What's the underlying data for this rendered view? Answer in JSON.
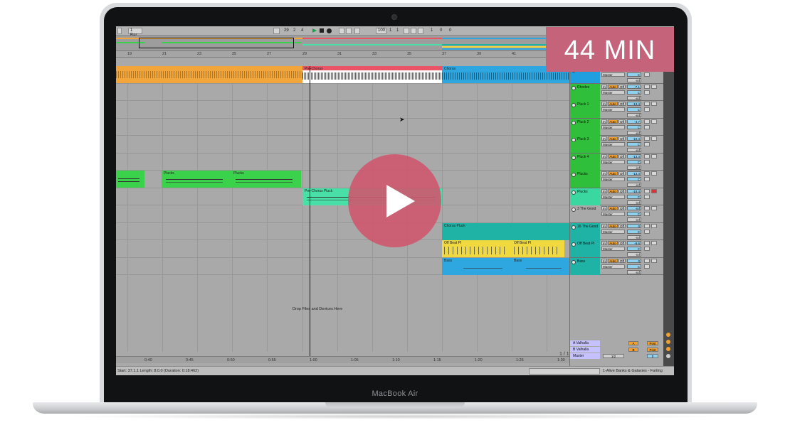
{
  "device": {
    "brand": "MacBook Air"
  },
  "overlay": {
    "duration_badge": "44 MIN",
    "play_button": "play-icon"
  },
  "transport": {
    "quantize": "1 Bar",
    "position": [
      "29",
      "2",
      "4"
    ],
    "tempo": "100",
    "meter": [
      "1",
      "1"
    ],
    "end": [
      "1",
      "0",
      "0"
    ]
  },
  "ruler": {
    "bars": [
      "19",
      "21",
      "23",
      "25",
      "27",
      "29",
      "31",
      "33",
      "35",
      "37",
      "39",
      "41",
      "43"
    ]
  },
  "bottom_ruler": {
    "times": [
      "0:40",
      "0:45",
      "0:50",
      "0:55",
      "1:00",
      "1:05",
      "1:10",
      "1:15",
      "1:20",
      "1:25",
      "1:30"
    ]
  },
  "arrangement": {
    "clips": [
      {
        "track": 0,
        "label": "Pre-Chorus"
      },
      {
        "track": 0,
        "label": "Chorus"
      },
      {
        "track": 6,
        "label": "Plucks"
      },
      {
        "track": 6,
        "label": "Plucks"
      },
      {
        "track": 7,
        "label": "Pre-Chorus Pluck"
      },
      {
        "track": 9,
        "label": "Chorus Pluck"
      },
      {
        "track": 10,
        "label": "Off Beat Pl"
      },
      {
        "track": 10,
        "label": "Off Beat Pl"
      },
      {
        "track": 11,
        "label": "Bass"
      },
      {
        "track": 11,
        "label": "Bass"
      }
    ],
    "drop_hint": "Drop Files and Devices Here",
    "page_indicator": "1 / 1"
  },
  "tracks": [
    {
      "name": "",
      "color": "#1f9ee0",
      "send": "Master",
      "vol": "-13.6",
      "pan": "C"
    },
    {
      "name": "Rhodes",
      "color": "#2fbf3a",
      "send": "Master",
      "vol": "-7.1",
      "pan": "C"
    },
    {
      "name": "Pluck 1",
      "color": "#2fbf3a",
      "send": "Master",
      "vol": "-13.4",
      "pan": "C"
    },
    {
      "name": "Pluck 2",
      "color": "#2fbf3a",
      "send": "Master",
      "vol": "-4.7",
      "pan": "C"
    },
    {
      "name": "Pluck 3",
      "color": "#2fbf3a",
      "send": "Master",
      "vol": "-19.4",
      "pan": "C"
    },
    {
      "name": "Pluck 4",
      "color": "#2fbf3a",
      "send": "Master",
      "vol": "-13.4",
      "pan": "C"
    },
    {
      "name": "Plucks",
      "color": "#2fbf3a",
      "send": "Master",
      "vol": "-13.4",
      "pan": "C"
    },
    {
      "name": "Plucks",
      "color": "#3ad7a0",
      "send": "Master",
      "vol": "-19.4",
      "pan": "C"
    },
    {
      "name": "3 The Good",
      "color": "#a9a9a9",
      "send": "Master",
      "vol": "-inf",
      "pan": "C"
    },
    {
      "name": "16 The Good",
      "color": "#1fb3a6",
      "send": "Master",
      "vol": "0",
      "pan": "C"
    },
    {
      "name": "Off Beat Pl",
      "color": "#1fb3a6",
      "send": "Master",
      "vol": "-9.6",
      "pan": "C"
    },
    {
      "name": "Bass",
      "color": "#1fb3a6",
      "send": "Master",
      "vol": "0",
      "pan": "C"
    }
  ],
  "returns": [
    {
      "name": "A Valhalla",
      "badge": "A",
      "badge2": "Post"
    },
    {
      "name": "B Valhalla",
      "badge": "B",
      "badge2": "Post"
    },
    {
      "name": "Master",
      "badge": "1/2",
      "vol": "0"
    }
  ],
  "mixer_labels": {
    "input": "In",
    "auto": "Auto",
    "off": "Off",
    "inf": "-inf"
  },
  "status": {
    "left": "Start: 37.1.1   Length: 8.0.0 (Duration: 0:18:462)",
    "right": "1-Alive Banks & Galaxies - Farting"
  },
  "colors": {
    "orange": "#f2a53a",
    "red": "#e95565",
    "blue": "#2ea7e0",
    "green": "#3ad24a",
    "mint": "#49e0a8",
    "teal": "#1fb3a6",
    "yellow": "#efd93f",
    "badge": "#c4637a"
  }
}
